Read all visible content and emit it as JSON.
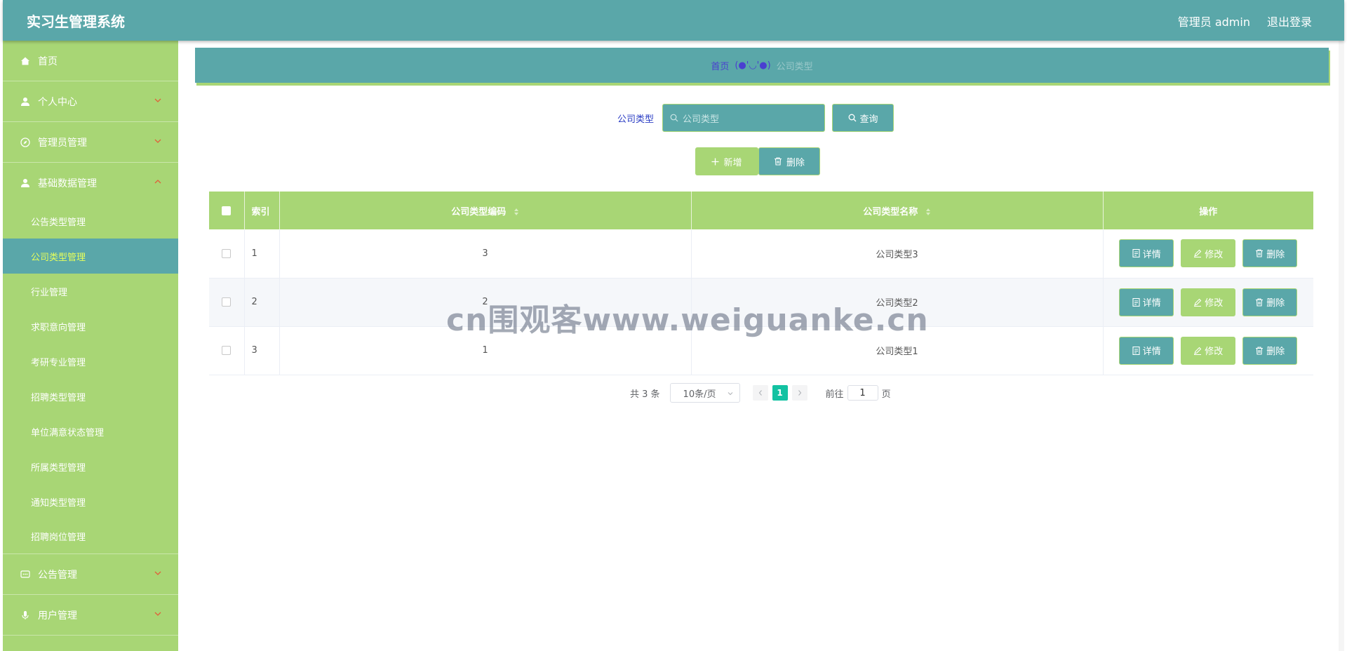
{
  "header": {
    "app_title": "实习生管理系统",
    "user_label": "管理员 admin",
    "logout_label": "退出登录"
  },
  "sidebar": {
    "items": [
      {
        "label": "首页",
        "icon": "home-icon"
      },
      {
        "label": "个人中心",
        "icon": "user-icon"
      },
      {
        "label": "管理员管理",
        "icon": "compass-icon"
      },
      {
        "label": "基础数据管理",
        "icon": "user-icon",
        "expanded": true
      },
      {
        "label": "公告管理",
        "icon": "chat-icon"
      },
      {
        "label": "用户管理",
        "icon": "microphone-icon"
      }
    ],
    "sub_items": [
      {
        "label": "公告类型管理"
      },
      {
        "label": "公司类型管理",
        "active": true
      },
      {
        "label": "行业管理"
      },
      {
        "label": "求职意向管理"
      },
      {
        "label": "考研专业管理"
      },
      {
        "label": "招聘类型管理"
      },
      {
        "label": "单位满意状态管理"
      },
      {
        "label": "所属类型管理"
      },
      {
        "label": "通知类型管理"
      },
      {
        "label": "招聘岗位管理"
      }
    ]
  },
  "breadcrumb": {
    "home": "首页",
    "separator": "(●'◡'●)",
    "current": "公司类型"
  },
  "search": {
    "label": "公司类型",
    "placeholder": "公司类型",
    "button_label": "查询"
  },
  "actions": {
    "add_label": "新增",
    "delete_label": "删除"
  },
  "table": {
    "headers": {
      "index": "索引",
      "code": "公司类型编码",
      "name": "公司类型名称",
      "ops": "操作"
    },
    "rows": [
      {
        "index": "1",
        "code": "3",
        "name": "公司类型3"
      },
      {
        "index": "2",
        "code": "2",
        "name": "公司类型2"
      },
      {
        "index": "3",
        "code": "1",
        "name": "公司类型1"
      }
    ],
    "op_labels": {
      "detail": "详情",
      "edit": "修改",
      "delete": "删除"
    }
  },
  "pagination": {
    "total": "共 3 条",
    "page_size": "10条/页",
    "current_page": "1",
    "goto_prefix": "前往",
    "goto_value": "1",
    "goto_suffix": "页"
  },
  "watermark": "cn围观客www.weiguanke.cn",
  "colors": {
    "teal": "#5aa7a9",
    "green": "#a8d675",
    "active_sub_text": "#e8ff5a",
    "page_active": "#13c2a2"
  }
}
